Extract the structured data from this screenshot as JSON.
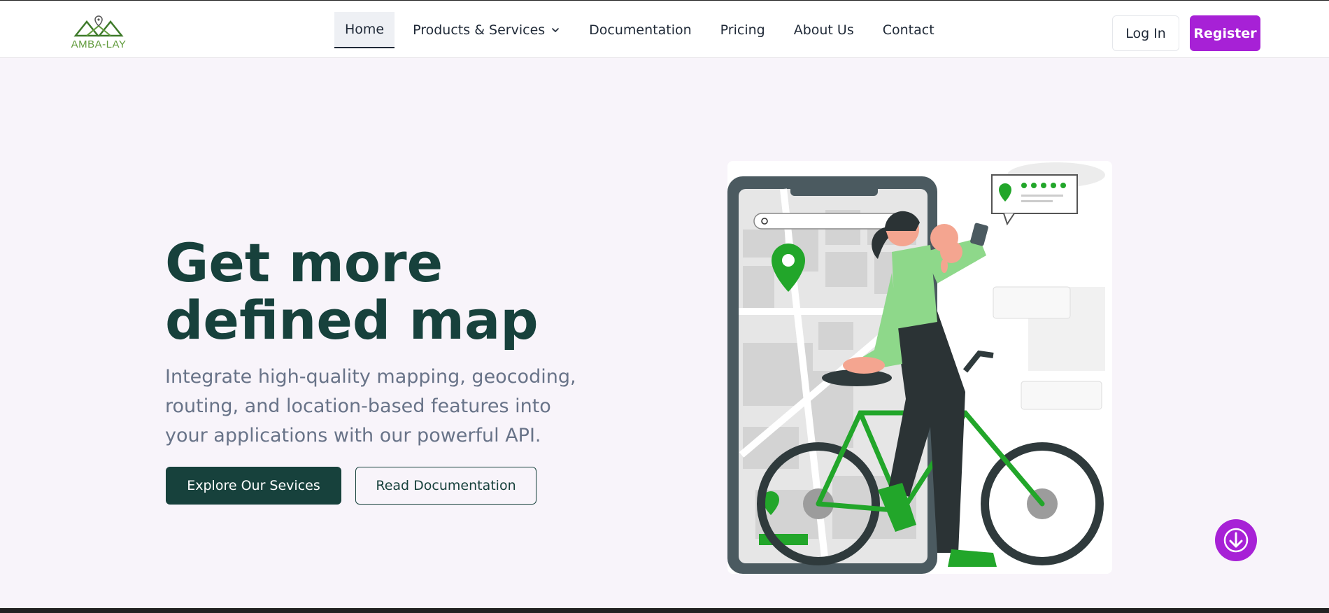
{
  "brand": {
    "name": "AMBA-LAY",
    "logo_icon": "mountain-pin-logo"
  },
  "nav": {
    "items": [
      {
        "label": "Home",
        "active": true
      },
      {
        "label": "Products & Services",
        "dropdown": true
      },
      {
        "label": "Documentation"
      },
      {
        "label": "Pricing"
      },
      {
        "label": "About Us"
      },
      {
        "label": "Contact"
      }
    ],
    "login_label": "Log In",
    "register_label": "Register"
  },
  "hero": {
    "title_line1": "Get more",
    "title_line2": "defined map",
    "subtitle": "Integrate high-quality mapping, geocoding, routing, and location-based features into your applications with our powerful API.",
    "primary_button": "Explore Our Sevices",
    "secondary_button": "Read Documentation"
  },
  "colors": {
    "brand_purple": "#a721d6",
    "brand_dark_green": "#17413c",
    "illustration_green": "#22a62a",
    "background": "#f8f4fa"
  },
  "icons": {
    "scroll_button": "arrow-down-icon",
    "dropdown": "chevron-down-icon"
  }
}
